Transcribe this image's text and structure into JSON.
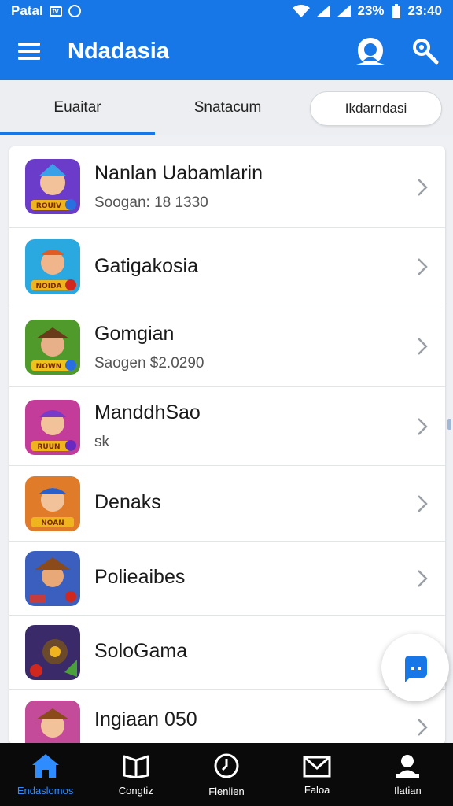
{
  "status_bar": {
    "left_text": "Patal",
    "box_label": "tv",
    "battery": "23%",
    "time": "23:40"
  },
  "app_bar": {
    "title": "Ndadasia"
  },
  "tabs": [
    {
      "label": "Euaitar",
      "active": true
    },
    {
      "label": "Snatacum",
      "active": false
    },
    {
      "label": "Ikdarndasi",
      "active": false
    }
  ],
  "items": [
    {
      "title": "Nanlan Uabamlarin",
      "subtitle": "Soogan: 18 1330",
      "icon_badge": "ROUIV"
    },
    {
      "title": "Gatigakosia",
      "subtitle": "",
      "icon_badge": "NOIDA"
    },
    {
      "title": "Gomgian",
      "subtitle": "Saogen $2.0290",
      "icon_badge": "NOWN"
    },
    {
      "title": "ManddhSao",
      "subtitle": "sk",
      "icon_badge": "RUUN"
    },
    {
      "title": "Denaks",
      "subtitle": "",
      "icon_badge": "NOAN"
    },
    {
      "title": "Polieaibes",
      "subtitle": "",
      "icon_badge": ""
    },
    {
      "title": "SoloGama",
      "subtitle": "",
      "icon_badge": ""
    },
    {
      "title": "Ingiaan 050",
      "subtitle": "",
      "icon_badge": ""
    }
  ],
  "bottom_nav": [
    {
      "label": "Endaslomos",
      "icon": "home-icon",
      "active": true
    },
    {
      "label": "Congtiz",
      "icon": "book-icon",
      "active": false
    },
    {
      "label": "Flenlien",
      "icon": "clock-icon",
      "active": false
    },
    {
      "label": "Faloa",
      "icon": "mail-icon",
      "active": false
    },
    {
      "label": "Ilatian",
      "icon": "profile-icon",
      "active": false
    }
  ],
  "colors": {
    "primary": "#1877e6",
    "nav_bg": "#0a0a0a",
    "nav_active": "#2f8cff"
  }
}
